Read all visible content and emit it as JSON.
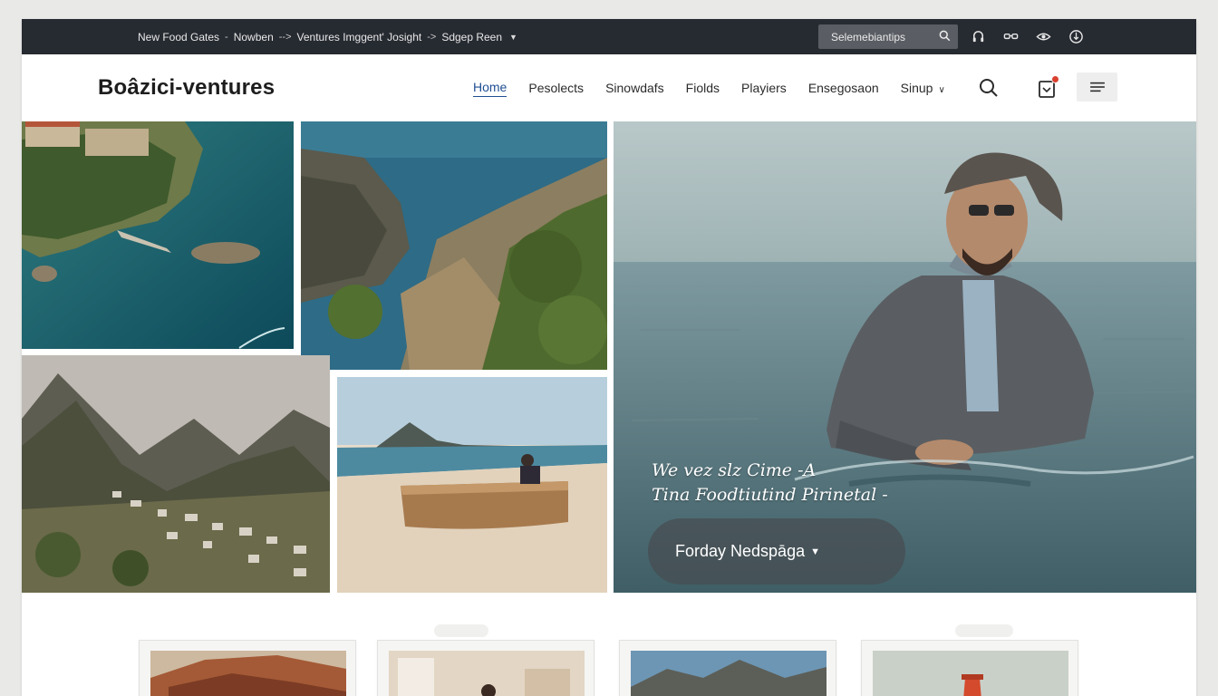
{
  "topbar": {
    "crumbs": [
      "New Food Gates",
      "Nowben",
      "Ventures Imggent' Josight",
      "Sdgep Reen"
    ],
    "crumb_separators": [
      "-",
      "-->",
      "->"
    ],
    "search_label": "Selemebiantips",
    "icons": [
      "headset-icon",
      "glasses-icon",
      "eye-icon",
      "globe-icon"
    ],
    "color": "#262a31"
  },
  "header": {
    "brand": "Boâzici-ventures",
    "nav": [
      "Home",
      "Pesolects",
      "Sinowdafs",
      "Fiolds",
      "Playiers",
      "Ensegosaon",
      "Sinup"
    ],
    "active_nav": "Home",
    "accent": "#1f4e92",
    "badge_color": "#d9412f"
  },
  "gallery": {
    "tiles": [
      "coastal-village-tile",
      "cliff-sea-tile",
      "mountain-town-tile",
      "beach-boat-tile"
    ]
  },
  "hero": {
    "caption_line1": "We vez slz Cime   -A",
    "caption_line2": "Tina Foodtiutind Pirinetal -",
    "button_label": "Forday Nedspāga"
  },
  "cards": {
    "items": [
      "canyon-card",
      "interior-card",
      "mountains-card",
      "lighthouse-card"
    ]
  }
}
